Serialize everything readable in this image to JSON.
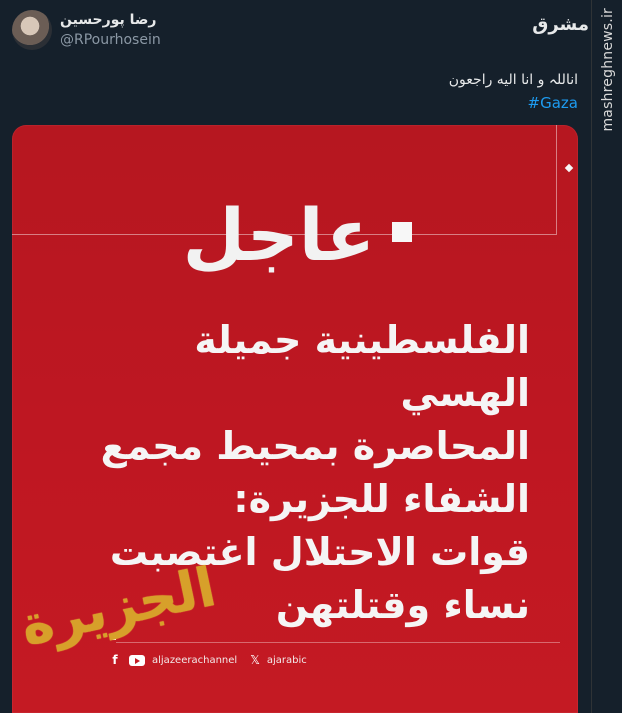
{
  "profile": {
    "display_name": "رضا پورحسین",
    "handle": "@RPourhosein"
  },
  "tweet": {
    "text": "اناللہ و انا الیه راجعون",
    "hashtag": "#Gaza"
  },
  "watermark": {
    "site": "mashreghnews.ir",
    "logo_text": "مشرق"
  },
  "card": {
    "headline": "عاجل",
    "body_lines": [
      "الفلسطينية جميلة الهسي",
      "المحاصرة بمحيط مجمع",
      "الشفاء للجزيرة:",
      "قوات الاحتلال اغتصبت",
      "نساء وقتلتهن"
    ],
    "social": {
      "facebook_youtube_handle": "aljazeerachannel",
      "x_handle": "ajarabic"
    },
    "logo_text": "الجزيرة"
  },
  "colors": {
    "background": "#15202b",
    "card_red": "#c41a23",
    "link_blue": "#1d9bf0",
    "logo_gold": "#d7a02a"
  }
}
